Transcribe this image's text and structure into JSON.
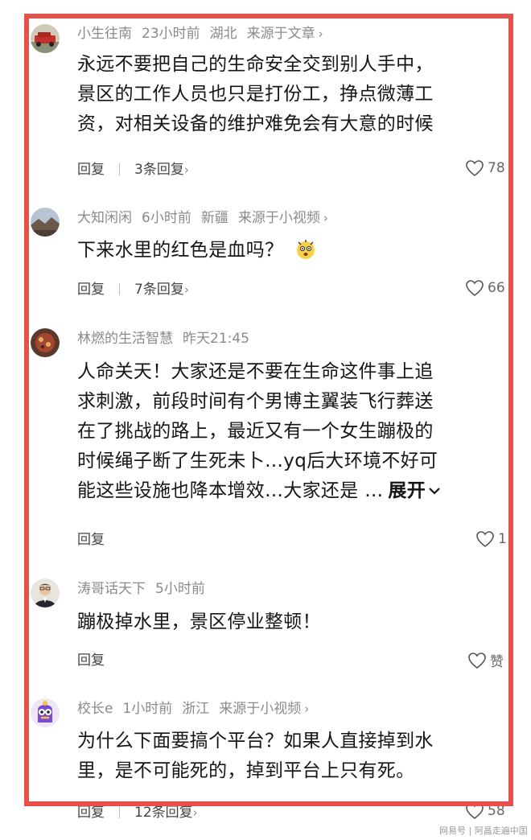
{
  "comments": [
    {
      "username": "小生往南",
      "time": "23小时前",
      "location": "湖北",
      "source": "来源于文章",
      "lines": [
        "永远不要把自己的生命安全交到别人手中，",
        "景区的工作人员也只是打份工，挣点微薄工",
        "资，对相关设备的维护难免会有大意的时候"
      ],
      "reply": "回复",
      "replies": "3条回复",
      "likes": "78"
    },
    {
      "username": "大知闲闲",
      "time": "6小时前",
      "location": "新疆",
      "source": "来源于小视频",
      "lines": [
        "下来水里的红色是血吗？"
      ],
      "reply": "回复",
      "replies": "7条回复",
      "likes": "66"
    },
    {
      "username": "林燃的生活智慧",
      "time": "昨天21:45",
      "lines": [
        "人命关天！大家还是不要在生命这件事上追",
        "求刺激，前段时间有个男博主翼装飞行葬送",
        "在了挑战的路上，最近又有一个女生蹦极的",
        "时候绳子断了生死未卜…yq后大环境不好可",
        "能这些设施也降本增效…大家还是 …"
      ],
      "expand": "展开",
      "reply": "回复",
      "likes": "1"
    },
    {
      "username": "涛哥话天下",
      "time": "5小时前",
      "lines": [
        "蹦极掉水里，景区停业整顿！"
      ],
      "reply": "回复",
      "likes": "赞"
    },
    {
      "username": "校长e",
      "time": "1小时前",
      "location": "浙江",
      "source": "来源于小视频",
      "lines": [
        "为什么下面要搞个平台？如果人直接掉到水",
        "里，是不可能死的，掉到平台上只有死。"
      ],
      "reply": "回复",
      "replies": "12条回复",
      "likes": "58"
    }
  ],
  "watermark": "网易号 | 阿昌走遍中国",
  "colors": {
    "frame": "#e8504a",
    "meta_text": "#8a8a8a",
    "body_text": "#161616"
  },
  "icons": [
    "chevron-right-icon",
    "heart-outline-icon",
    "shocked-face-emoji",
    "chevron-down-icon"
  ]
}
